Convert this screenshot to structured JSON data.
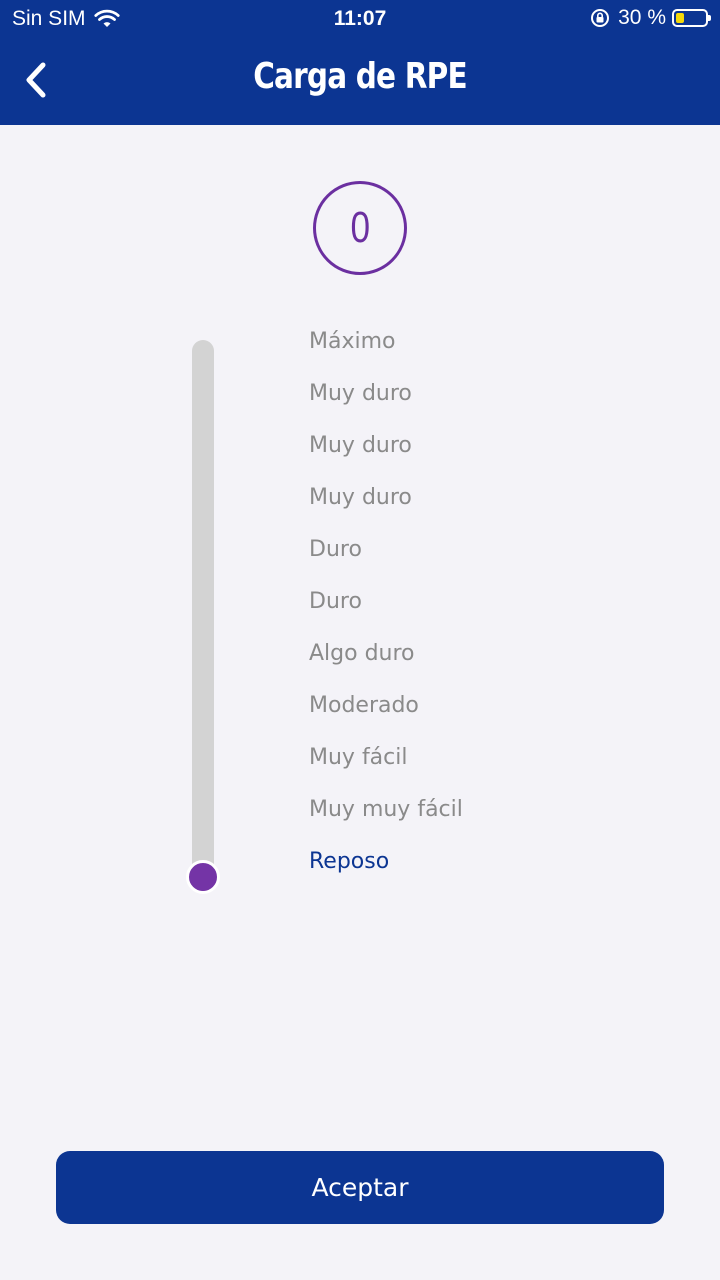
{
  "status_bar": {
    "carrier": "Sin SIM",
    "time": "11:07",
    "battery_percent": "30 %",
    "battery_level": 0.3,
    "icons": [
      "wifi-icon",
      "orientation-lock-icon",
      "battery-icon"
    ]
  },
  "header": {
    "title": "Carga de RPE",
    "back_icon": "chevron-left-icon"
  },
  "rpe": {
    "value": "0",
    "slider_value": 0,
    "slider_max": 10,
    "scale": [
      "Máximo",
      "Muy duro",
      "Muy duro",
      "Muy duro",
      "Duro",
      "Duro",
      "Algo duro",
      "Moderado",
      "Muy fácil",
      "Muy muy fácil",
      "Reposo"
    ],
    "selected_label": "Reposo"
  },
  "actions": {
    "accept_label": "Aceptar"
  },
  "colors": {
    "primary": "#0c3592",
    "accent": "#6b2fa0",
    "thumb": "#7434a6",
    "label": "#8a8a8a",
    "background": "#f4f3f8",
    "track": "#d3d3d3"
  }
}
